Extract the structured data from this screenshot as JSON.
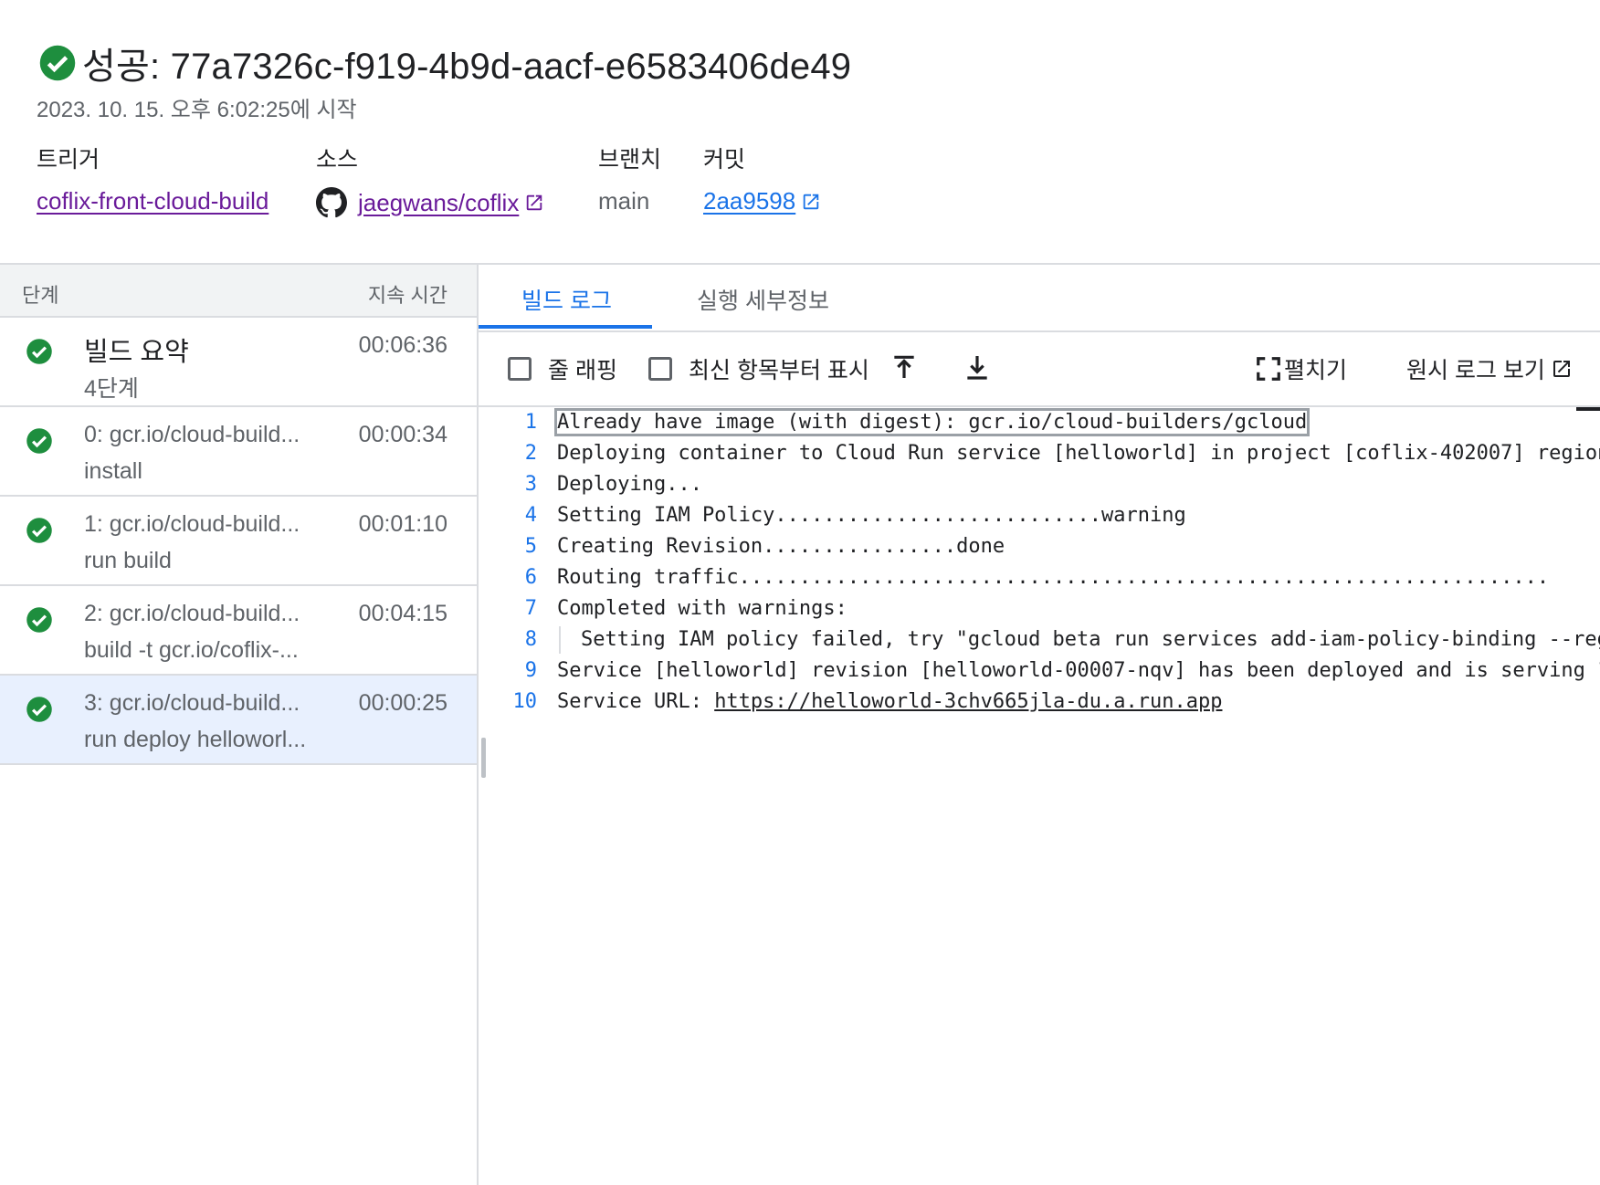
{
  "header": {
    "title": "성공: 77a7326c-f919-4b9d-aacf-e6583406de49",
    "started": "2023. 10. 15. 오후 6:02:25에 시작",
    "trigger_label": "트리거",
    "trigger_value": "coflix-front-cloud-build",
    "source_label": "소스",
    "source_value": "jaegwans/coflix",
    "branch_label": "브랜치",
    "branch_value": "main",
    "commit_label": "커밋",
    "commit_value": "2aa9598"
  },
  "steps": {
    "col_step": "단계",
    "col_duration": "지속 시간",
    "items": [
      {
        "name": "빌드 요약",
        "sub": "4단계",
        "duration": "00:06:36"
      },
      {
        "name": "0: gcr.io/cloud-build...",
        "sub": "install",
        "duration": "00:00:34"
      },
      {
        "name": "1: gcr.io/cloud-build...",
        "sub": "run build",
        "duration": "00:01:10"
      },
      {
        "name": "2: gcr.io/cloud-build...",
        "sub": "build -t gcr.io/coflix-...",
        "duration": "00:04:15"
      },
      {
        "name": "3: gcr.io/cloud-build...",
        "sub": "run deploy helloworl...",
        "duration": "00:00:25"
      }
    ]
  },
  "tabs": {
    "build_log": "빌드 로그",
    "exec_details": "실행 세부정보"
  },
  "toolbar": {
    "wrap": "줄 래핑",
    "newest_first": "최신 항목부터 표시",
    "expand": "펼치기",
    "raw_log": "원시 로그 보기"
  },
  "log": {
    "lines": [
      {
        "n": "1",
        "t": "Already have image (with digest): gcr.io/cloud-builders/gcloud"
      },
      {
        "n": "2",
        "t": "Deploying container to Cloud Run service [helloworld] in project [coflix-402007] region"
      },
      {
        "n": "3",
        "t": "Deploying..."
      },
      {
        "n": "4",
        "t": "Setting IAM Policy...........................warning"
      },
      {
        "n": "5",
        "t": "Creating Revision................done"
      },
      {
        "n": "6",
        "t": "Routing traffic..................................................................."
      },
      {
        "n": "7",
        "t": "Completed with warnings:"
      },
      {
        "n": "8",
        "t": "Setting IAM policy failed, try \"gcloud beta run services add-iam-policy-binding --reg"
      },
      {
        "n": "9",
        "t": "Service [helloworld] revision [helloworld-00007-nqv] has been deployed and is serving 1"
      },
      {
        "n": "10",
        "t": "Service URL: "
      }
    ],
    "service_url": "https://helloworld-3chv665jla-du.a.run.app"
  },
  "colors": {
    "success": "#1e8e3e",
    "accent": "#1a73e8",
    "link_visited": "#6a1b9a"
  },
  "icons": {
    "success": "check-circle-icon",
    "github": "github-icon",
    "external": "open-in-new-icon",
    "scroll_top": "vertical-align-top-icon",
    "scroll_bottom": "download-icon",
    "expand": "fullscreen-icon"
  }
}
